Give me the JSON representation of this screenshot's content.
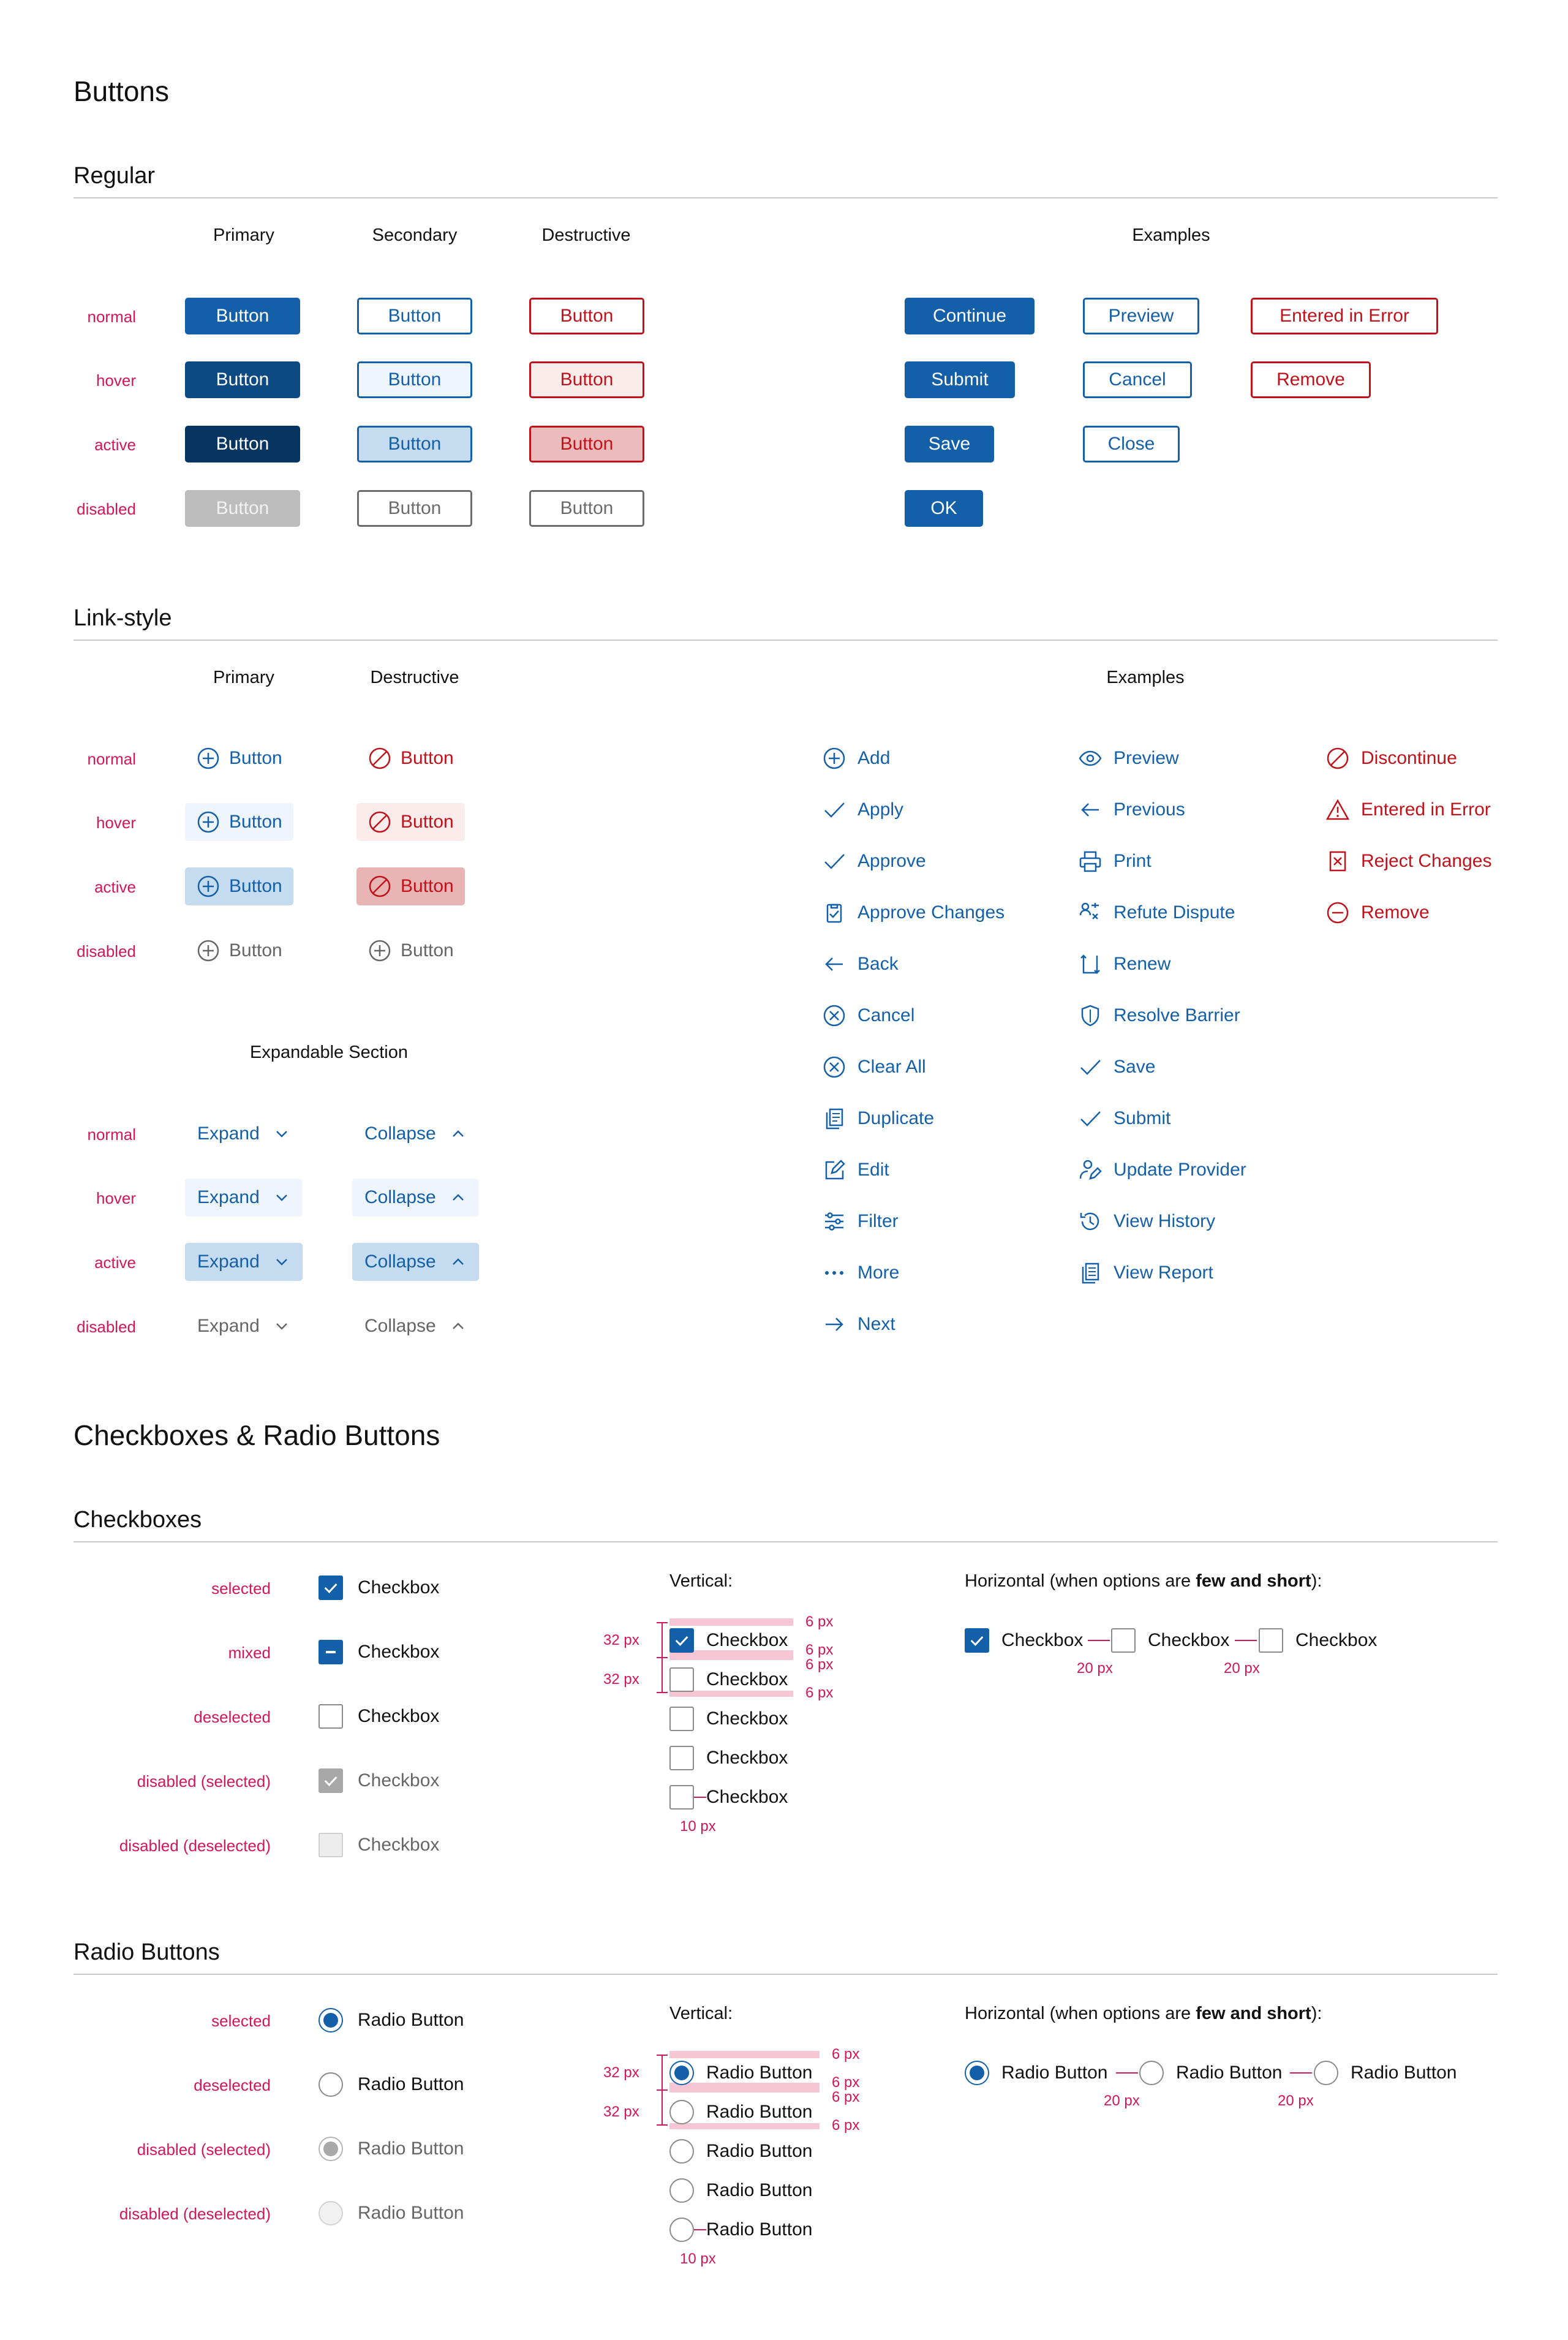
{
  "page": {
    "title": "Buttons",
    "title2": "Checkboxes & Radio Buttons"
  },
  "colors": {
    "primary": "#1460a8",
    "destructive": "#c0121b",
    "state_label": "#d0175a",
    "spec": "#d0175a"
  },
  "states": [
    "normal",
    "hover",
    "active",
    "disabled"
  ],
  "regular": {
    "title": "Regular",
    "col_primary": "Primary",
    "col_secondary": "Secondary",
    "col_destructive": "Destructive",
    "col_examples": "Examples",
    "button_label": "Button",
    "examples": {
      "primary": [
        "Continue",
        "Submit",
        "Save",
        "OK"
      ],
      "secondary": [
        "Preview",
        "Cancel",
        "Close"
      ],
      "destructive": [
        "Entered in Error",
        "Remove"
      ]
    }
  },
  "link_style": {
    "title": "Link-style",
    "col_primary": "Primary",
    "col_destructive": "Destructive",
    "col_examples": "Examples",
    "button_label": "Button",
    "examples_col1": [
      {
        "label": "Add",
        "icon": "plus-circle-icon"
      },
      {
        "label": "Apply",
        "icon": "check-icon"
      },
      {
        "label": "Approve",
        "icon": "check-icon"
      },
      {
        "label": "Approve Changes",
        "icon": "clipboard-check-icon"
      },
      {
        "label": "Back",
        "icon": "arrow-left-icon"
      },
      {
        "label": "Cancel",
        "icon": "x-circle-icon"
      },
      {
        "label": "Clear All",
        "icon": "x-circle-icon"
      },
      {
        "label": "Duplicate",
        "icon": "duplicate-icon"
      },
      {
        "label": "Edit",
        "icon": "edit-icon"
      },
      {
        "label": "Filter",
        "icon": "sliders-icon"
      },
      {
        "label": "More",
        "icon": "ellipsis-icon"
      },
      {
        "label": "Next",
        "icon": "arrow-right-icon"
      }
    ],
    "examples_col2": [
      {
        "label": "Preview",
        "icon": "eye-icon"
      },
      {
        "label": "Previous",
        "icon": "arrow-left-icon"
      },
      {
        "label": "Print",
        "icon": "printer-icon"
      },
      {
        "label": "Refute Dispute",
        "icon": "refute-icon"
      },
      {
        "label": "Renew",
        "icon": "renew-icon"
      },
      {
        "label": "Resolve Barrier",
        "icon": "shield-icon"
      },
      {
        "label": "Save",
        "icon": "check-icon"
      },
      {
        "label": "Submit",
        "icon": "check-icon"
      },
      {
        "label": "Update Provider",
        "icon": "user-edit-icon"
      },
      {
        "label": "View History",
        "icon": "history-icon"
      },
      {
        "label": "View Report",
        "icon": "report-icon"
      }
    ],
    "examples_col3": [
      {
        "label": "Discontinue",
        "icon": "no-entry-icon"
      },
      {
        "label": "Entered in Error",
        "icon": "warning-icon"
      },
      {
        "label": "Reject Changes",
        "icon": "doc-x-icon"
      },
      {
        "label": "Remove",
        "icon": "minus-circle-icon"
      }
    ]
  },
  "expandable": {
    "title": "Expandable Section",
    "expand": "Expand",
    "collapse": "Collapse"
  },
  "checkboxes": {
    "title": "Checkboxes",
    "states": [
      "selected",
      "mixed",
      "deselected",
      "disabled (selected)",
      "disabled (deselected)"
    ],
    "label": "Checkbox",
    "vertical_title": "Vertical:",
    "horizontal_prefix": "Horizontal (when options are ",
    "horizontal_bold": "few and short",
    "horizontal_suffix": "):",
    "m32": "32 px",
    "m6": "6 px",
    "m10": "10 px",
    "m20": "20 px"
  },
  "radios": {
    "title": "Radio Buttons",
    "states": [
      "selected",
      "deselected",
      "disabled (selected)",
      "disabled (deselected)"
    ],
    "label": "Radio Button",
    "vertical_title": "Vertical:",
    "horizontal_prefix": "Horizontal (when options are ",
    "horizontal_bold": "few and short",
    "horizontal_suffix": "):",
    "m32": "32 px",
    "m6": "6 px",
    "m10": "10 px",
    "m20": "20 px"
  }
}
